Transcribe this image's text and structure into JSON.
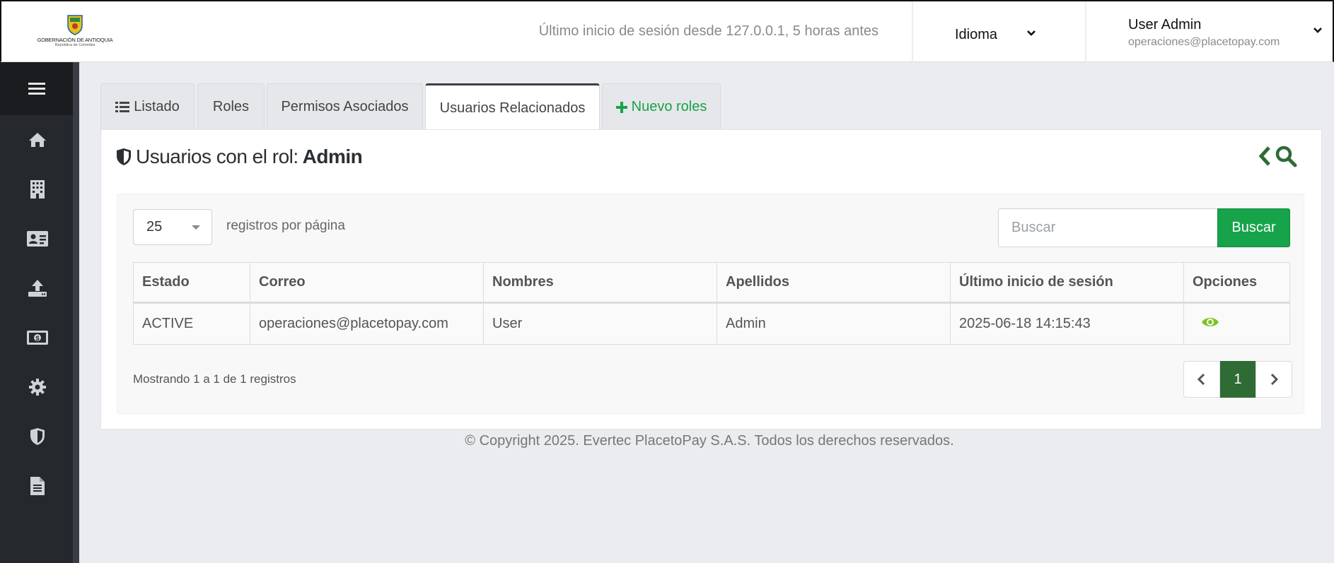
{
  "header": {
    "logo_line1": "GOBERNACIÓN DE ANTIOQUIA",
    "logo_line2": "República de Colombia",
    "last_login": "Último inicio de sesión desde 127.0.0.1, 5 horas antes",
    "language_label": "Idioma",
    "user_name": "User Admin",
    "user_email": "operaciones@placetopay.com"
  },
  "sidebar": {
    "items": [
      "menu-icon",
      "home-icon",
      "building-icon",
      "id-card-icon",
      "upload-icon",
      "money-icon",
      "gear-icon",
      "shield-icon",
      "document-icon"
    ]
  },
  "tabs": [
    {
      "label": "Listado"
    },
    {
      "label": "Roles"
    },
    {
      "label": "Permisos Asociados"
    },
    {
      "label": "Usuarios Relacionados"
    },
    {
      "label": "Nuevo roles"
    }
  ],
  "panel": {
    "title_prefix": "Usuarios con el rol:",
    "title_role": "Admin"
  },
  "controls": {
    "per_page_value": "25",
    "per_page_label": "registros por página",
    "search_placeholder": "Buscar",
    "search_button": "Buscar"
  },
  "table": {
    "headers": [
      "Estado",
      "Correo",
      "Nombres",
      "Apellidos",
      "Último inicio de sesión",
      "Opciones"
    ],
    "rows": [
      {
        "estado": "ACTIVE",
        "correo": "operaciones@placetopay.com",
        "nombres": "User",
        "apellidos": "Admin",
        "ultimo_inicio": "2025-06-18 14:15:43"
      }
    ]
  },
  "pagination": {
    "summary": "Mostrando 1 a 1 de 1 registros",
    "current_page": "1"
  },
  "footer": {
    "copyright": "© Copyright 2025. Evertec PlacetoPay S.A.S. Todos los derechos reservados."
  },
  "colors": {
    "primary_green": "#16a34a",
    "dark_green": "#2f6b34",
    "sidebar": "#25282c",
    "eye_icon": "#7cc425"
  }
}
